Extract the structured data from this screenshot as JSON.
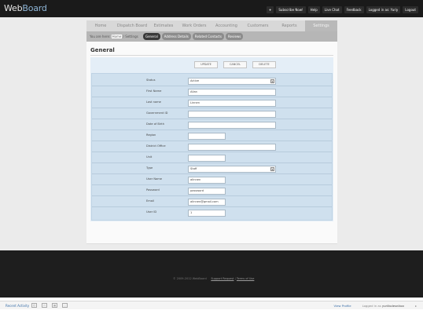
{
  "app": {
    "logo_prefix": "Web",
    "logo_suffix": "Board"
  },
  "top_links": [
    "+",
    "Subscribe Now!",
    "Help",
    "Live Chat",
    "Feedback",
    "Logged in as: Yuriy",
    "Logout"
  ],
  "main_tabs": [
    {
      "label": "Home",
      "active": false
    },
    {
      "label": "Dispatch Board",
      "active": false
    },
    {
      "label": "Estimates",
      "active": false
    },
    {
      "label": "Work Orders",
      "active": false
    },
    {
      "label": "Accounting",
      "active": false
    },
    {
      "label": "Customers",
      "active": false
    },
    {
      "label": "Reports",
      "active": false
    },
    {
      "label": "Settings",
      "active": true
    }
  ],
  "breadcrumb": {
    "prefix": "You are here:",
    "current": "Home",
    "separator": "/",
    "section": "Settings"
  },
  "sub_tabs": [
    {
      "label": "General",
      "active": true
    },
    {
      "label": "Address Details",
      "active": false
    },
    {
      "label": "Related Contacts",
      "active": false
    },
    {
      "label": "Reviews",
      "active": false
    }
  ],
  "page": {
    "title": "General"
  },
  "actions": {
    "update": "UPDATE",
    "cancel": "CANCEL",
    "delete": "DELETE"
  },
  "form": {
    "fields": [
      {
        "label": "Status",
        "value": "Active",
        "size": "l",
        "dropdown": true
      },
      {
        "label": "First Name",
        "value": "Allan",
        "size": "l"
      },
      {
        "label": "Last name",
        "value": "Linnen",
        "size": "l"
      },
      {
        "label": "Government ID",
        "value": "",
        "size": "l"
      },
      {
        "label": "Date of Birth",
        "value": "",
        "size": "l"
      },
      {
        "label": "Region",
        "value": "",
        "size": "s"
      },
      {
        "label": "District Office",
        "value": "",
        "size": "l"
      },
      {
        "label": "Unit",
        "value": "",
        "size": "s"
      },
      {
        "label": "Type",
        "value": "Staff",
        "size": "l",
        "dropdown": true
      },
      {
        "label": "User Name",
        "value": "alinnen",
        "size": "s"
      },
      {
        "label": "Password",
        "value": "password",
        "size": "s"
      },
      {
        "label": "Email",
        "value": "alinnen@gmail.com",
        "size": "s"
      },
      {
        "label": "User ID",
        "value": "1",
        "size": "s"
      }
    ]
  },
  "footer": {
    "copyright": "© 2009-2012 WebBoard",
    "support": "Support Request",
    "divider": "|",
    "terms": "Terms of Use"
  },
  "bottom_bar": {
    "recent": "Recent Activity",
    "view_profile": "View Profile",
    "logged_prefix": "Logged in as",
    "logged_user": "yuriikolesnikov",
    "arrow": "▸"
  }
}
